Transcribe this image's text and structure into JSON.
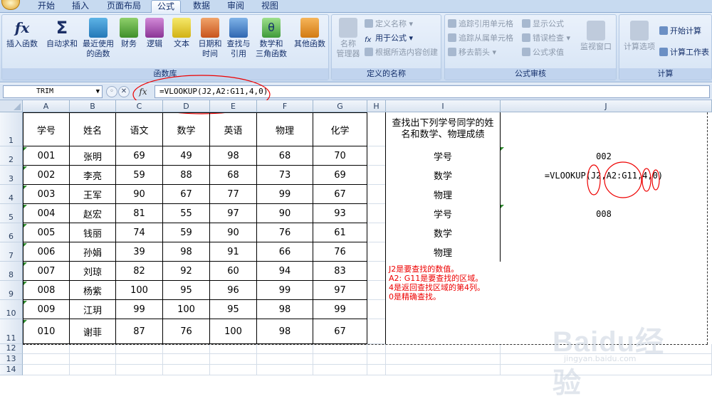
{
  "tabs": [
    {
      "label": "开始"
    },
    {
      "label": "插入"
    },
    {
      "label": "页面布局"
    },
    {
      "label": "公式"
    },
    {
      "label": "数据"
    },
    {
      "label": "审阅"
    },
    {
      "label": "视图"
    }
  ],
  "ribbon": {
    "function_library": {
      "caption": "函数库",
      "buttons": [
        {
          "label": "插入函数"
        },
        {
          "label": "自动求和"
        },
        {
          "label": "最近使用\n的函数"
        },
        {
          "label": "财务"
        },
        {
          "label": "逻辑"
        },
        {
          "label": "文本"
        },
        {
          "label": "日期和\n时间"
        },
        {
          "label": "查找与\n引用"
        },
        {
          "label": "数学和\n三角函数"
        },
        {
          "label": "其他函数"
        }
      ]
    },
    "defined_names": {
      "caption": "定义的名称",
      "manager": "名称\n管理器",
      "define": "定义名称",
      "use": "用于公式",
      "create": "根据所选内容创建"
    },
    "formula_auditing": {
      "caption": "公式审核",
      "trace_precedents": "追踪引用单元格",
      "trace_dependents": "追踪从属单元格",
      "remove_arrows": "移去箭头",
      "show_formulas": "显示公式",
      "error_checking": "错误检查",
      "evaluate": "公式求值",
      "watch": "监视窗口"
    },
    "calculation": {
      "caption": "计算",
      "options": "计算选项",
      "calc_now": "开始计算",
      "calc_sheet": "计算工作表"
    }
  },
  "formula_bar": {
    "name_box": "TRIM",
    "fx": "fx",
    "formula": "=VLOOKUP(J2,A2:G11,4,0)"
  },
  "columns": [
    "A",
    "B",
    "C",
    "D",
    "E",
    "F",
    "G",
    "H",
    "I",
    "J"
  ],
  "rows": [
    "1",
    "2",
    "3",
    "4",
    "5",
    "6",
    "7",
    "8",
    "9",
    "10",
    "11",
    "12",
    "13",
    "14"
  ],
  "table": {
    "headers": [
      "学号",
      "姓名",
      "语文",
      "数学",
      "英语",
      "物理",
      "化学"
    ],
    "rows": [
      [
        "001",
        "张明",
        "69",
        "49",
        "98",
        "68",
        "70"
      ],
      [
        "002",
        "李亮",
        "59",
        "88",
        "68",
        "73",
        "69"
      ],
      [
        "003",
        "王军",
        "90",
        "67",
        "77",
        "99",
        "67"
      ],
      [
        "004",
        "赵宏",
        "81",
        "55",
        "97",
        "90",
        "93"
      ],
      [
        "005",
        "钱丽",
        "74",
        "59",
        "90",
        "76",
        "61"
      ],
      [
        "006",
        "孙娟",
        "39",
        "98",
        "91",
        "66",
        "76"
      ],
      [
        "007",
        "刘琼",
        "82",
        "92",
        "60",
        "94",
        "83"
      ],
      [
        "008",
        "杨紫",
        "100",
        "95",
        "96",
        "99",
        "97"
      ],
      [
        "009",
        "江玥",
        "99",
        "100",
        "95",
        "98",
        "99"
      ],
      [
        "010",
        "谢菲",
        "87",
        "76",
        "100",
        "98",
        "67"
      ]
    ]
  },
  "lookup": {
    "title": "查找出下列学号同学的姓名和数学、物理成绩",
    "labels": [
      "学号",
      "数学",
      "物理",
      "学号",
      "数学",
      "物理"
    ],
    "j2": "002",
    "j3": "=VLOOKUP(J2,A2:G11,4,0)",
    "j5": "008"
  },
  "notes": [
    "J2是要查找的数值。",
    "A2: G11是要查找的区域。",
    "4是返回查找区域的第4列。",
    "0是精确查找。"
  ],
  "watermark": {
    "brand": "Baidu经验",
    "url": "jingyan.baidu.com"
  },
  "colors": {
    "annotation": "#e00000",
    "ribbon_bg": "#dbe7f6",
    "tab_text": "#15306b"
  }
}
